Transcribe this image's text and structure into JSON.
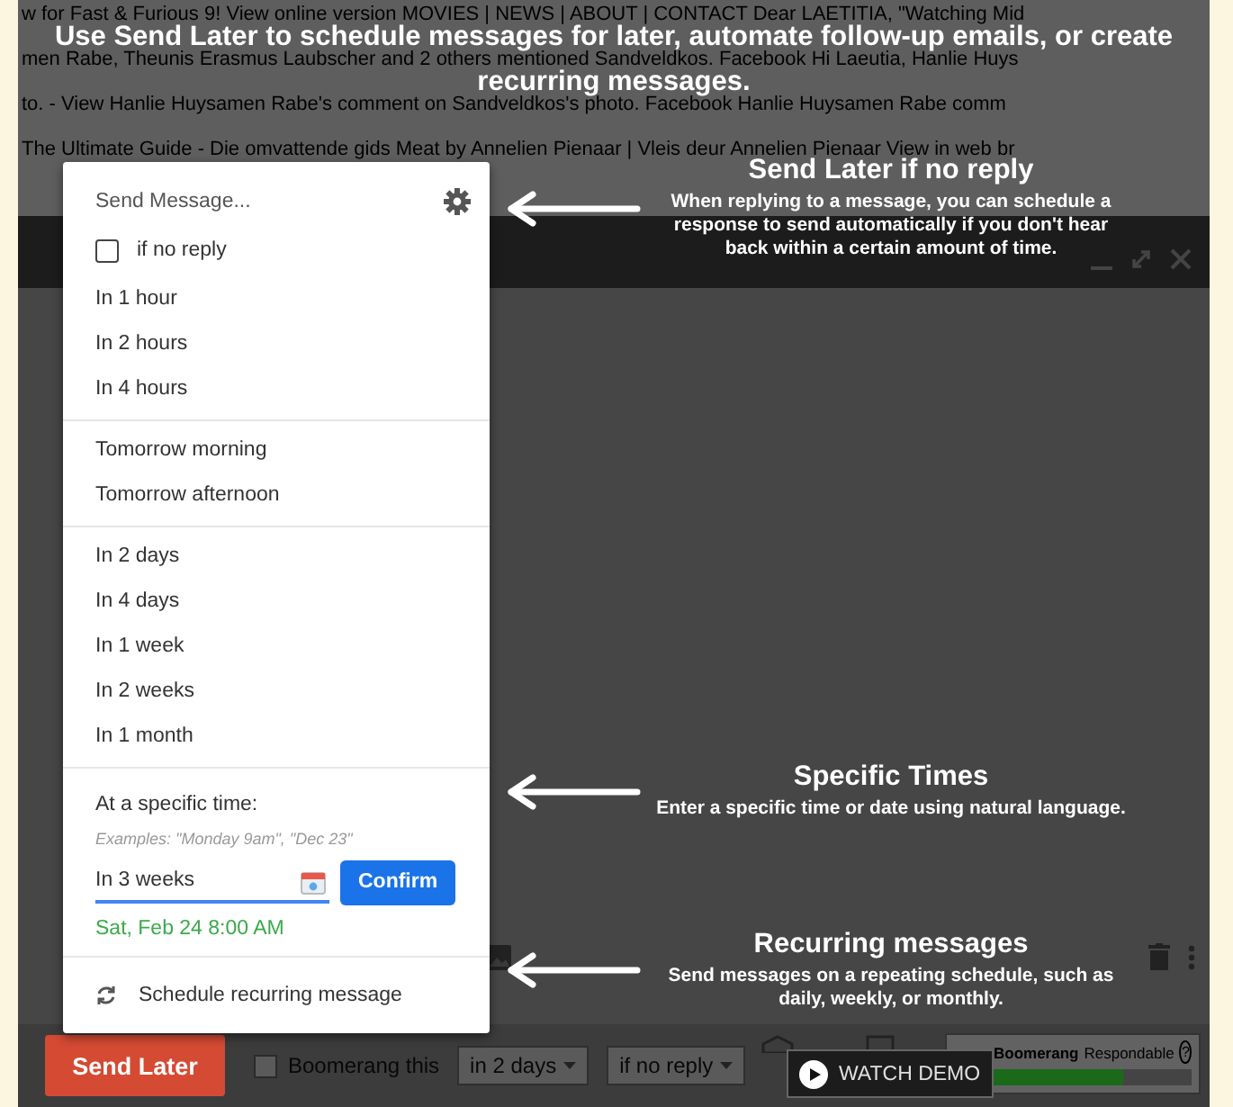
{
  "background_page": {
    "lines": [
      "w for Fast & Furious 9! View online version MOVIES | NEWS | ABOUT | CONTACT Dear LAETITIA, \"Watching Mid",
      "men Rabe, Theunis Erasmus Laubscher and 2 others mentioned Sandveldkos. Facebook Hi Laeutia, Hanlie Huys",
      "to. - View Hanlie Huysamen Rabe's comment on Sandveldkos's photo. Facebook Hanlie Huysamen Rabe comm",
      "The Ultimate Guide - Die omvattende gids Meat by Annelien Pienaar | Vleis deur Annelien Pienaar View in web br"
    ]
  },
  "overlay_title_lines": [
    "Use Send Later to schedule messages for later, automate follow-up emails, or create",
    "recurring messages."
  ],
  "menu": {
    "title": "Send Message...",
    "if_no_reply": {
      "label": "if no reply",
      "checked": false
    },
    "groups": [
      [
        "In 1 hour",
        "In 2 hours",
        "In 4 hours"
      ],
      [
        "Tomorrow morning",
        "Tomorrow afternoon"
      ],
      [
        "In 2 days",
        "In 4 days",
        "In 1 week",
        "In 2 weeks",
        "In 1 month"
      ]
    ],
    "specific_time": {
      "label": "At a specific time:",
      "hint": "Examples: \"Monday 9am\", \"Dec 23\"",
      "value": "In 3 weeks",
      "confirm": "Confirm",
      "parsed": "Sat, Feb 24 8:00 AM"
    },
    "recurring": "Schedule recurring message"
  },
  "annotations": [
    {
      "title": "Send Later if no reply",
      "text": "When replying to a message, you can schedule a response to send automatically if you don't hear back within a certain amount of time."
    },
    {
      "title": "Specific Times",
      "text": "Enter a specific time or date using natural language."
    },
    {
      "title": "Recurring messages",
      "text": "Send messages on a repeating schedule, such as daily, weekly, or monthly."
    }
  ],
  "bottom_bar": {
    "send_button": "Send Later",
    "boomerang": {
      "label": "Boomerang this",
      "checked": false
    },
    "dropdowns": [
      "in 2 days",
      "if no reply"
    ],
    "respondable": {
      "brand": "Boomerang",
      "name": "Respondable",
      "help": "?",
      "level": 0.65
    }
  },
  "watch_demo": "WATCH DEMO"
}
